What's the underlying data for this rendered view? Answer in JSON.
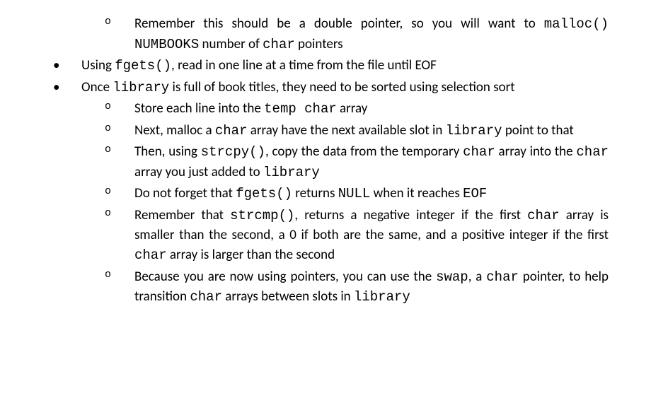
{
  "items": [
    {
      "type": "sub",
      "segments": [
        {
          "text": "Remember this should be a double pointer, so you will want to ",
          "mono": false
        },
        {
          "text": "malloc()",
          "mono": true
        },
        {
          "text": " ",
          "mono": false
        },
        {
          "text": "NUMBOOKS",
          "mono": true
        },
        {
          "text": " number of ",
          "mono": false
        },
        {
          "text": "char",
          "mono": true
        },
        {
          "text": " pointers",
          "mono": false
        }
      ]
    },
    {
      "type": "main",
      "segments": [
        {
          "text": "Using ",
          "mono": false
        },
        {
          "text": "fgets()",
          "mono": true
        },
        {
          "text": ", read in one line at a time from the file until EOF",
          "mono": false
        }
      ]
    },
    {
      "type": "sub",
      "segments": [
        {
          "text": "Store each line into the ",
          "mono": false
        },
        {
          "text": "temp char",
          "mono": true
        },
        {
          "text": " array",
          "mono": false
        }
      ]
    },
    {
      "type": "sub",
      "segments": [
        {
          "text": "Next, malloc a ",
          "mono": false
        },
        {
          "text": "char",
          "mono": true
        },
        {
          "text": " array have the next available slot in ",
          "mono": false
        },
        {
          "text": "library",
          "mono": true
        },
        {
          "text": " point to that",
          "mono": false
        }
      ]
    },
    {
      "type": "sub",
      "segments": [
        {
          "text": "Then, using ",
          "mono": false
        },
        {
          "text": "strcpy()",
          "mono": true
        },
        {
          "text": ", copy the data from the temporary ",
          "mono": false
        },
        {
          "text": "char",
          "mono": true
        },
        {
          "text": " array into the ",
          "mono": false
        },
        {
          "text": "char",
          "mono": true
        },
        {
          "text": " array you just added to ",
          "mono": false
        },
        {
          "text": "library",
          "mono": true
        }
      ]
    },
    {
      "type": "sub",
      "segments": [
        {
          "text": "Do not forget that ",
          "mono": false
        },
        {
          "text": "fgets()",
          "mono": true
        },
        {
          "text": " returns ",
          "mono": false
        },
        {
          "text": "NULL",
          "mono": true
        },
        {
          "text": " when it reaches ",
          "mono": false
        },
        {
          "text": "EOF",
          "mono": true
        }
      ]
    },
    {
      "type": "main",
      "segments": [
        {
          "text": "Once ",
          "mono": false
        },
        {
          "text": "library",
          "mono": true
        },
        {
          "text": " is full of book titles, they need to be sorted using selection sort",
          "mono": false
        }
      ]
    },
    {
      "type": "sub",
      "segments": [
        {
          "text": "Remember that ",
          "mono": false
        },
        {
          "text": "strcmp()",
          "mono": true
        },
        {
          "text": ", returns a negative integer if the first ",
          "mono": false
        },
        {
          "text": "char",
          "mono": true
        },
        {
          "text": " array is smaller than the second, a 0 if both are the same, and a positive integer if the first ",
          "mono": false
        },
        {
          "text": "char",
          "mono": true
        },
        {
          "text": " array is larger than the second",
          "mono": false
        }
      ]
    },
    {
      "type": "sub",
      "segments": [
        {
          "text": "Because you are now using pointers, you can use the ",
          "mono": false
        },
        {
          "text": "swap",
          "mono": true
        },
        {
          "text": ", a  ",
          "mono": false
        },
        {
          "text": "char",
          "mono": true
        },
        {
          "text": " pointer, to help transition ",
          "mono": false
        },
        {
          "text": "char",
          "mono": true
        },
        {
          "text": " arrays between slots in ",
          "mono": false
        },
        {
          "text": "library",
          "mono": true
        }
      ]
    }
  ]
}
